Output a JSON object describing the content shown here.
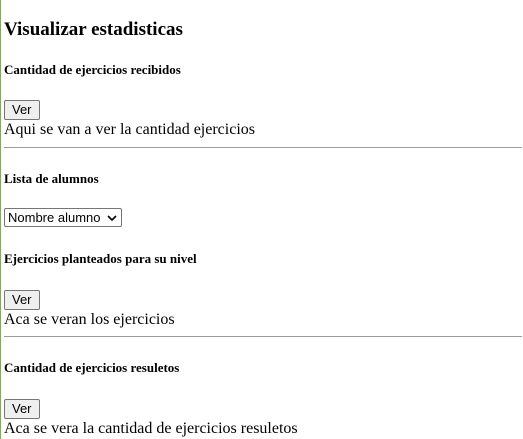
{
  "page": {
    "title": "Visualizar estadisticas"
  },
  "sections": {
    "received": {
      "heading": "Cantidad de ejercicios recibidos",
      "button_label": "Ver",
      "text": "Aqui se van a ver la cantidad ejercicios"
    },
    "students": {
      "heading": "Lista de alumnos",
      "select_value": "Nombre alumno"
    },
    "planned": {
      "heading": "Ejercicios planteados para su nivel",
      "button_label": "Ver",
      "text": "Aca se veran los ejercicios"
    },
    "solved": {
      "heading": "Cantidad de ejercicios resuletos",
      "button_label": "Ver",
      "text": "Aca se vera la cantidad de ejercicios resuletos"
    }
  },
  "colors": {
    "left_border": "#7cb342",
    "divider": "#9a9a9a"
  }
}
